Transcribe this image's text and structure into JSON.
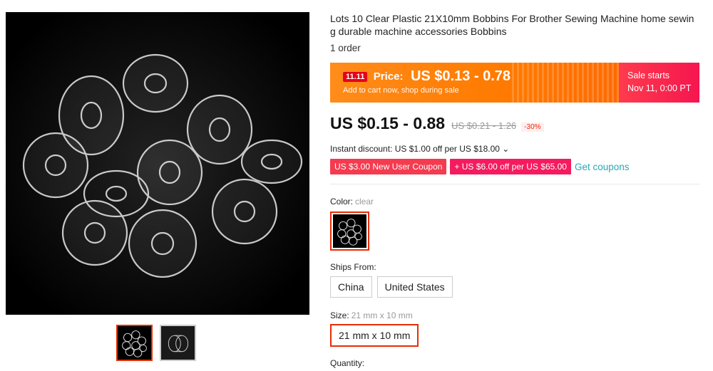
{
  "product": {
    "title": "Lots 10 Clear Plastic 21X10mm Bobbins For Brother Sewing Machine home sewing durable machine accessories Bobbins",
    "orders": "1 order"
  },
  "banner": {
    "badge": "11.11",
    "price_label": "Price:",
    "price": "US $0.13 - 0.78",
    "sub": "Add to cart now, shop during sale",
    "sale_line1": "Sale starts",
    "sale_line2": "Nov 11, 0:00 PT"
  },
  "pricing": {
    "price": "US $0.15 - 0.88",
    "original_price": "US $0.21 - 1.26",
    "discount": "-30%"
  },
  "instant_discount": "Instant discount: US $1.00 off per US $18.00 ⌄",
  "coupons": {
    "new_user": "US $3.00 New User Coupon",
    "store": "+ US $6.00 off per US $65.00",
    "get": "Get coupons"
  },
  "options": {
    "color_label": "Color:",
    "color_value": "clear",
    "ships_label": "Ships From:",
    "ships": [
      "China",
      "United States"
    ],
    "size_label": "Size:",
    "size_value": "21 mm x 10 mm",
    "size_option": "21 mm x 10 mm",
    "quantity_label": "Quantity:"
  },
  "icons": {
    "main": "bobbins-product-image",
    "thumb1": "bobbins-thumbnail",
    "thumb2": "bobbin-thumbnail"
  },
  "colors": {
    "accent": "#e62e04",
    "banner_orange": "#ff7a00",
    "banner_red": "#f5164f",
    "link": "#2aa6b7"
  }
}
